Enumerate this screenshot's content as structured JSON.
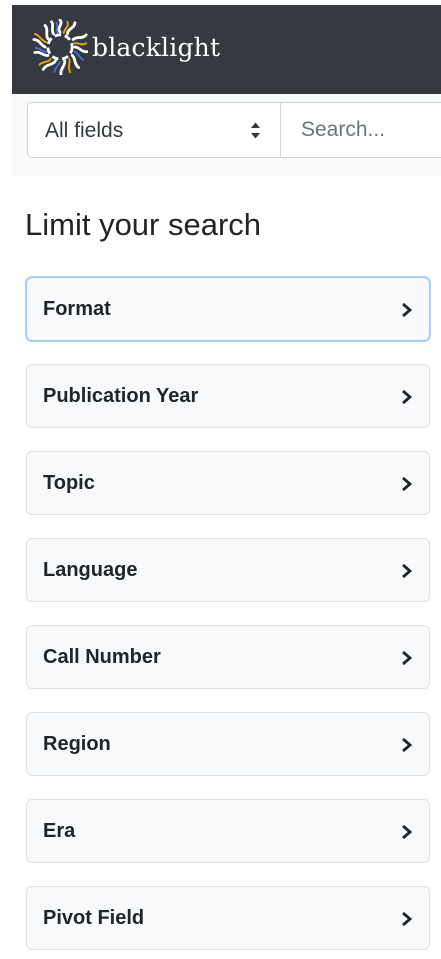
{
  "brand": {
    "name": "blacklight",
    "logo_icon": "sun-burst-logo"
  },
  "search": {
    "field_selected": "All fields",
    "placeholder": "Search..."
  },
  "facets": {
    "heading": "Limit your search",
    "items": [
      {
        "label": "Format",
        "state": "focused"
      },
      {
        "label": "Publication Year",
        "state": "collapsed"
      },
      {
        "label": "Topic",
        "state": "collapsed"
      },
      {
        "label": "Language",
        "state": "collapsed"
      },
      {
        "label": "Call Number",
        "state": "collapsed"
      },
      {
        "label": "Region",
        "state": "collapsed"
      },
      {
        "label": "Era",
        "state": "collapsed"
      },
      {
        "label": "Pivot Field",
        "state": "collapsed"
      }
    ]
  },
  "colors": {
    "navbar": "#343a40",
    "search_bar_bg": "#f8f9fa",
    "facet_bg": "#f8f9fa",
    "focus_ring": "#9ec5fe"
  }
}
